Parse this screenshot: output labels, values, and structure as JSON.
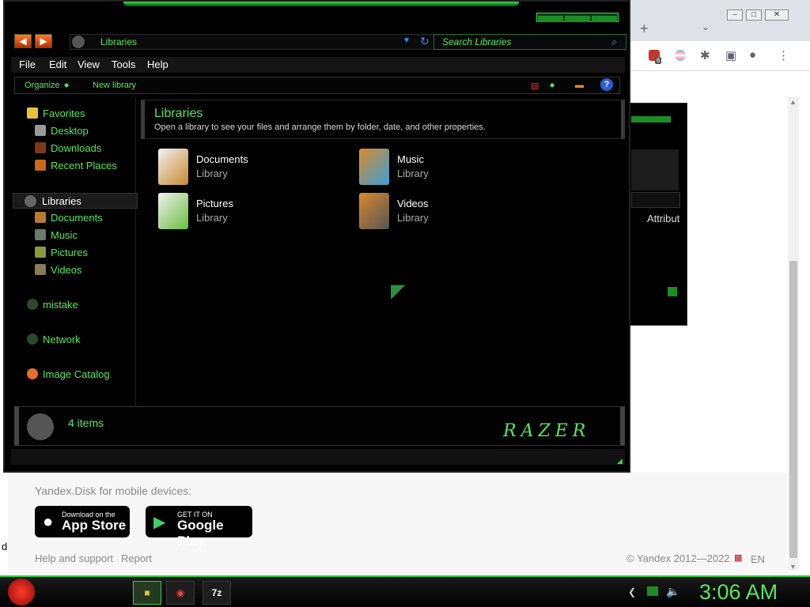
{
  "explorer": {
    "address": "Libraries",
    "search_placeholder": "Search Libraries",
    "menu": [
      "File",
      "Edit",
      "View",
      "Tools",
      "Help"
    ],
    "toolbar": {
      "organize": "Organize",
      "new_library": "New library",
      "help": "?"
    },
    "nav": {
      "favorites": "Favorites",
      "desktop": "Desktop",
      "downloads": "Downloads",
      "recent": "Recent Places",
      "libraries": "Libraries",
      "documents": "Documents",
      "music": "Music",
      "pictures": "Pictures",
      "videos": "Videos",
      "mistake": "mistake",
      "network": "Network",
      "image_catalog": "Image Catalog"
    },
    "content": {
      "title": "Libraries",
      "subtitle": "Open a library to see your files and arrange them by folder, date, and other properties.",
      "items": [
        {
          "name": "Documents",
          "type": "Library"
        },
        {
          "name": "Music",
          "type": "Library"
        },
        {
          "name": "Pictures",
          "type": "Library"
        },
        {
          "name": "Videos",
          "type": "Library"
        }
      ]
    },
    "status": "4 items",
    "logo": "RAZER"
  },
  "background_dialog": {
    "attribute_label": "Attribut"
  },
  "browser": {
    "mobile_label": "Yandex.Disk for mobile devices:",
    "appstore": {
      "line1": "Download on the",
      "line2": "App Store"
    },
    "googleplay": {
      "line1": "GET IT ON",
      "line2": "Google Play"
    },
    "help_link": "Help and support",
    "report_link": "Report",
    "copyright": "© Yandex 2012—2022",
    "language": "EN",
    "badge_count": "6",
    "left_edge_char": "d"
  },
  "taskbar": {
    "time": "3:06 AM",
    "app3": "7z"
  },
  "colors": {
    "accent": "#56e85a",
    "border": "#2bd63a"
  }
}
